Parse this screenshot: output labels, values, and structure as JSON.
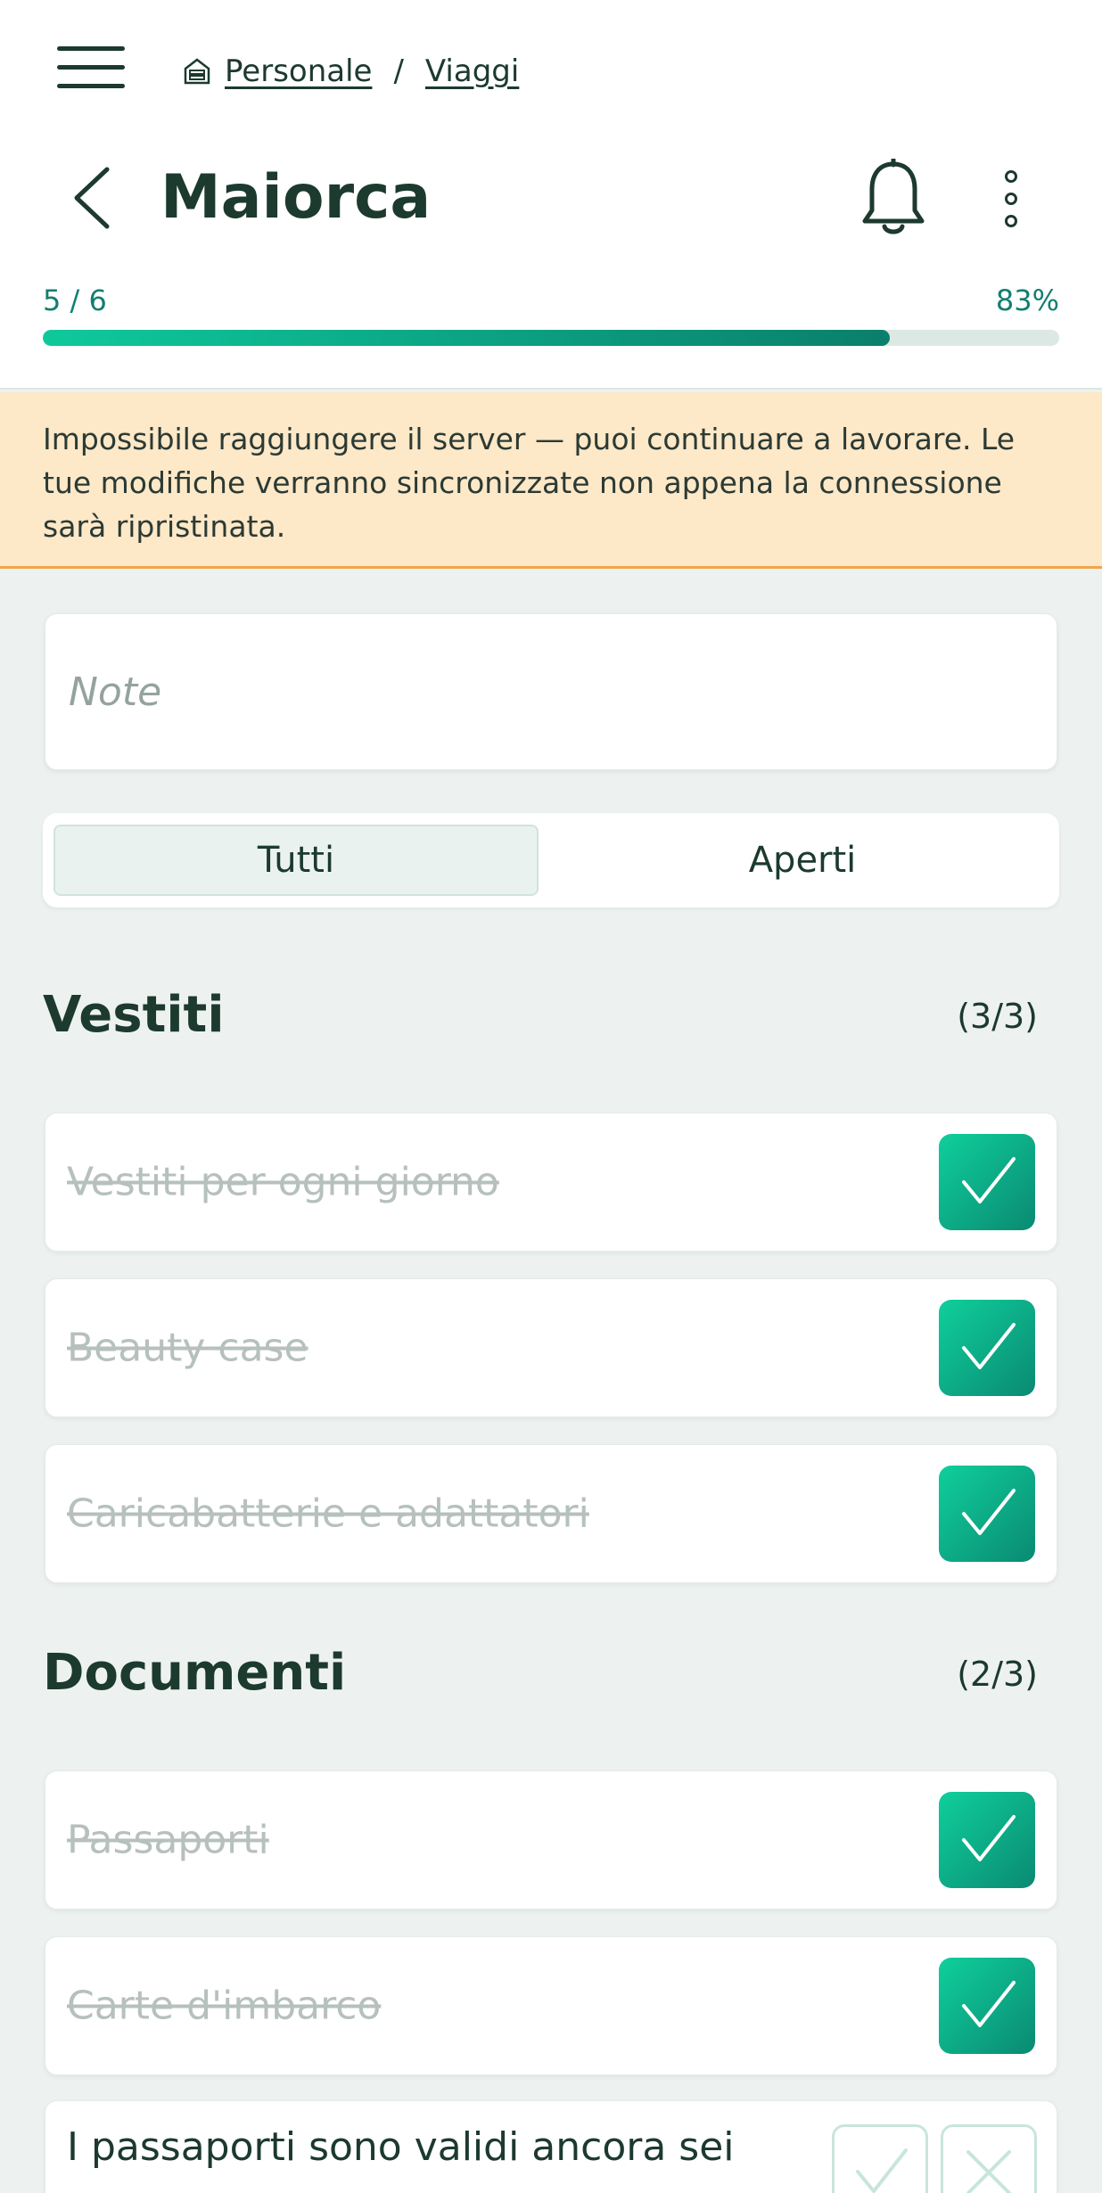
{
  "breadcrumb": {
    "home_icon": "home-icon",
    "parent": "Personale",
    "separator": "/",
    "current": "Viaggi"
  },
  "header": {
    "title": "Maiorca",
    "back_icon": "chevron-left-icon",
    "bell_icon": "bell-icon",
    "menu_icon": "kebab-menu-icon"
  },
  "progress": {
    "count": "5 / 6",
    "percent_label": "83%",
    "fraction": 0.833
  },
  "banner": {
    "message": "Impossibile raggiungere il server — puoi continuare a lavorare. Le tue modifiche verranno sincronizzate non appena la connessione sarà ripristinata."
  },
  "notes": {
    "placeholder": "Note",
    "value": ""
  },
  "filter": {
    "all": "Tutti",
    "open": "Aperti",
    "selected": "Tutti"
  },
  "sections": [
    {
      "title": "Vestiti",
      "count": "(3/3)",
      "items": [
        {
          "label": "Vestiti per ogni giorno",
          "checked": true
        },
        {
          "label": "Beauty case",
          "checked": true
        },
        {
          "label": "Caricabatterie e adattatori",
          "checked": true
        }
      ]
    },
    {
      "title": "Documenti",
      "count": "(2/3)",
      "items": [
        {
          "label": "Passaporti",
          "checked": true
        },
        {
          "label": "Carte d'imbarco",
          "checked": true
        },
        {
          "label": "I passaporti sono validi ancora sei",
          "checked": false
        }
      ]
    }
  ],
  "colors": {
    "accent": "#0ec99b",
    "accent_dark": "#0a7f6c",
    "banner_bg": "#fde8c8",
    "banner_border": "#f0a54a",
    "text": "#1c3a2e"
  }
}
